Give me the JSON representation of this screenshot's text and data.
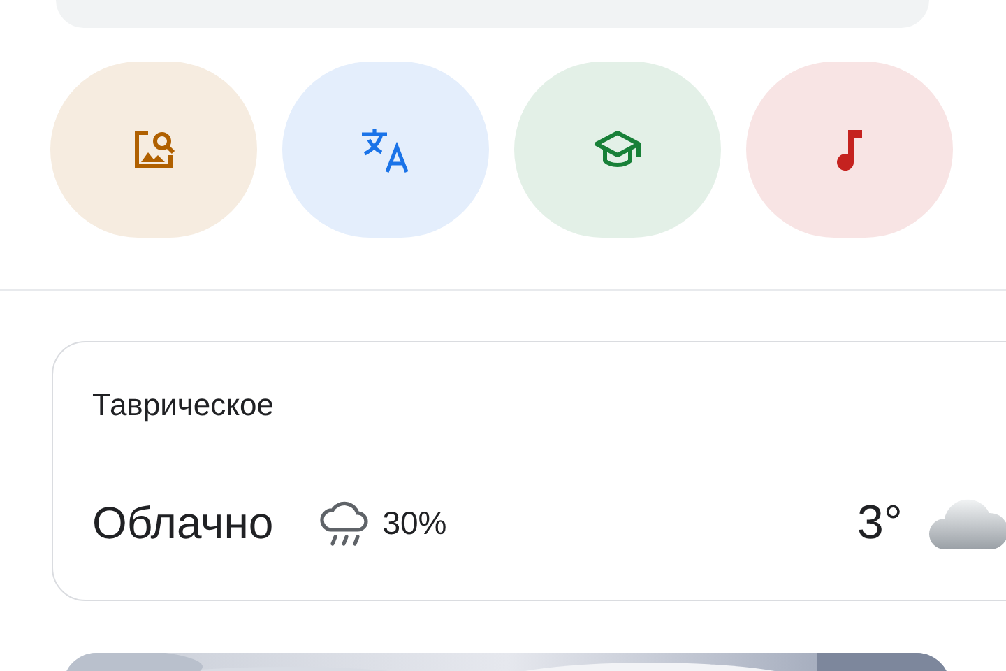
{
  "shortcuts": [
    {
      "kind": "image-search",
      "color": "#b06000"
    },
    {
      "kind": "translate",
      "color": "#1a73e8"
    },
    {
      "kind": "education",
      "color": "#188038"
    },
    {
      "kind": "music",
      "color": "#c5221f"
    }
  ],
  "weather": {
    "location": "Таврическое",
    "condition": "Облачно",
    "precipitation": "30%",
    "temperature": "3°"
  }
}
